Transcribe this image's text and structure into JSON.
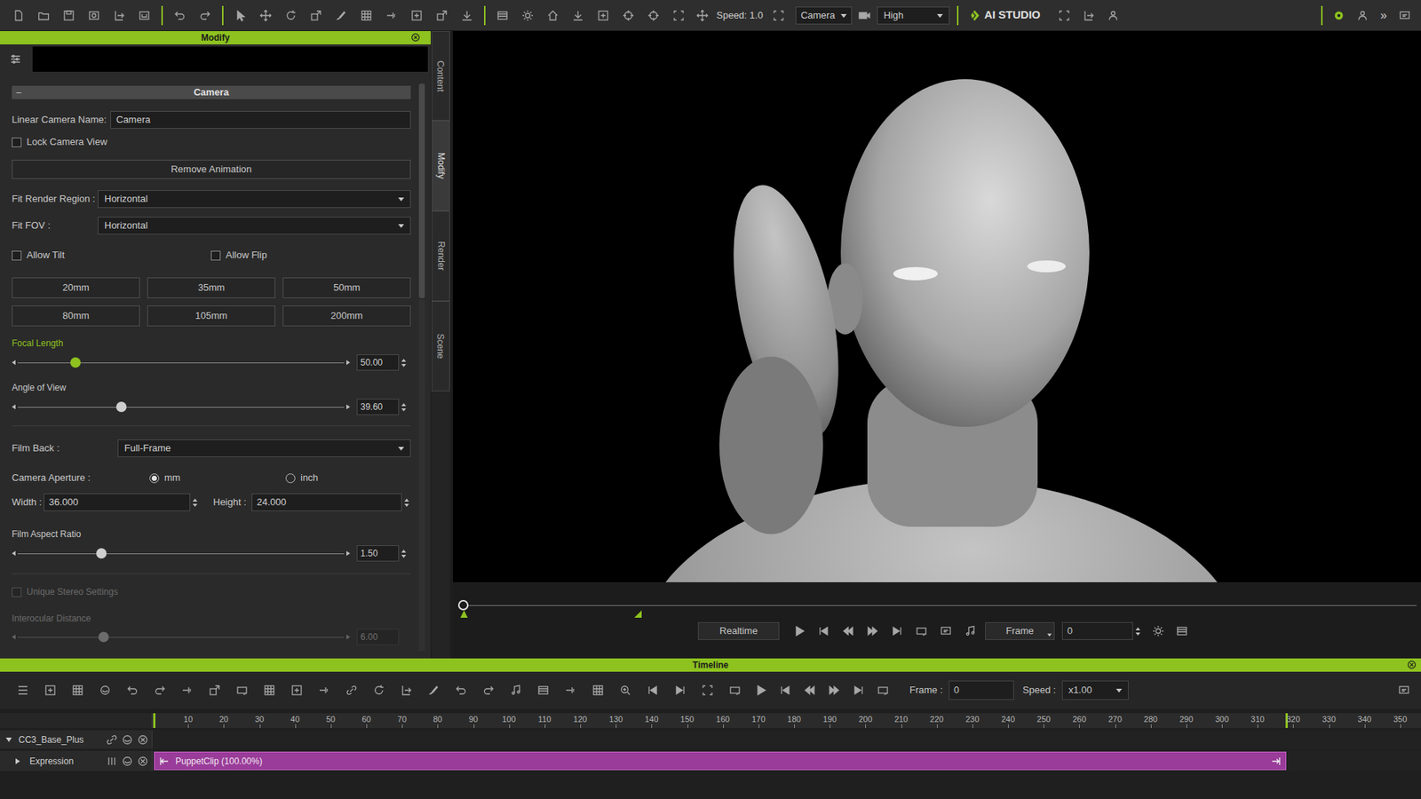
{
  "toolbar": {
    "speed": "Speed: 1.0",
    "camera_select": "Camera",
    "quality_select": "High",
    "ai_studio": "AI STUDIO",
    "more": "»"
  },
  "modify_panel": {
    "title": "Modify",
    "section": {
      "toggle": "–",
      "title": "Camera"
    },
    "camera_name": {
      "label": "Linear Camera Name:",
      "value": "Camera"
    },
    "lock_camera_view": {
      "label": "Lock Camera View",
      "checked": false
    },
    "remove_animation": "Remove Animation",
    "fit_render_region": {
      "label": "Fit Render Region :",
      "value": "Horizontal"
    },
    "fit_fov": {
      "label": "Fit FOV :",
      "value": "Horizontal"
    },
    "allow_tilt": {
      "label": "Allow Tilt",
      "checked": false
    },
    "allow_flip": {
      "label": "Allow Flip",
      "checked": false
    },
    "lens_presets": [
      "20mm",
      "35mm",
      "50mm",
      "80mm",
      "105mm",
      "200mm"
    ],
    "focal_length": {
      "label": "Focal Length",
      "value": "50.00",
      "level": 0.178,
      "highlighted": true
    },
    "angle_of_view": {
      "label": "Angle of View",
      "value": "39.60",
      "level": 0.318
    },
    "film_back": {
      "label": "Film Back :",
      "value": "Full-Frame"
    },
    "camera_aperture": {
      "label": "Camera Aperture :",
      "options": [
        {
          "label": "mm",
          "selected": true
        },
        {
          "label": "inch",
          "selected": false
        }
      ]
    },
    "width": {
      "label": "Width :",
      "value": "36.000"
    },
    "height": {
      "label": "Height :",
      "value": "24.000"
    },
    "film_aspect_ratio": {
      "label": "Film Aspect Ratio",
      "value": "1.50",
      "level": 0.256
    },
    "unique_stereo_settings": {
      "label": "Unique Stereo Settings",
      "checked": false,
      "disabled": true
    },
    "interocular_distance": {
      "label": "Interocular Distance",
      "value": "6.00",
      "level": 0.264,
      "disabled": true
    }
  },
  "side_tabs": [
    {
      "label": "Content",
      "selected": false
    },
    {
      "label": "Modify",
      "selected": true
    },
    {
      "label": "Render",
      "selected": false
    },
    {
      "label": "Scene",
      "selected": false
    }
  ],
  "playback": {
    "scrubber_level": 0,
    "range_end_level": 0.183,
    "mode": "Realtime",
    "unit": "Frame",
    "frame": "0"
  },
  "timeline": {
    "title": "Timeline",
    "frame_label": "Frame :",
    "frame": "0",
    "speed_label": "Speed :",
    "speed": "x1.00",
    "ruler": [
      "10",
      "20",
      "30",
      "40",
      "50",
      "60",
      "70",
      "80",
      "90",
      "100",
      "110",
      "120",
      "130",
      "140",
      "150",
      "160",
      "170",
      "180",
      "190",
      "200",
      "210",
      "220",
      "230",
      "240",
      "250",
      "260",
      "270",
      "280",
      "290",
      "300",
      "310",
      "320",
      "330",
      "340",
      "350"
    ],
    "tracks": [
      {
        "name": "CC3_Base_Plus",
        "expanded": true
      },
      {
        "name": "Expression",
        "expanded": false,
        "clip": "PuppetClip (100.00%)"
      }
    ]
  }
}
